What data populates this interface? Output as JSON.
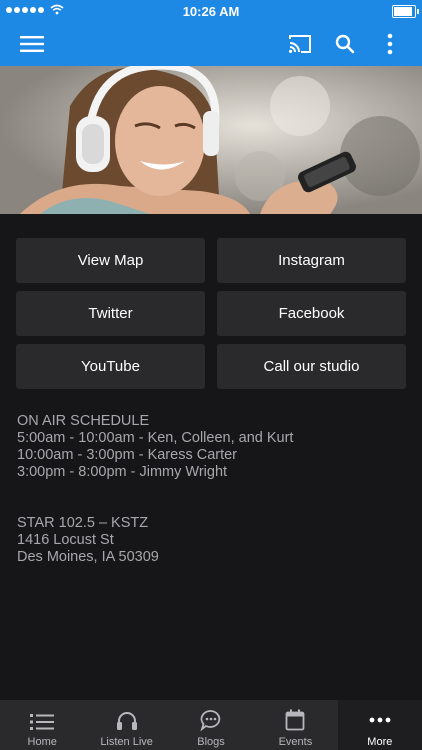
{
  "status_bar": {
    "time": "10:26 AM",
    "battery_level": 1.0
  },
  "toolbar": {
    "menu_icon": "hamburger-menu-icon",
    "cast_icon": "cast-icon",
    "search_icon": "search-icon",
    "more_icon": "more-vertical-icon",
    "background_color": "#1e88e5"
  },
  "buttons": [
    {
      "label": "View Map"
    },
    {
      "label": "Instagram"
    },
    {
      "label": "Twitter"
    },
    {
      "label": "Facebook"
    },
    {
      "label": "YouTube"
    },
    {
      "label": "Call our studio"
    }
  ],
  "schedule": {
    "heading": "ON AIR SCHEDULE",
    "lines": [
      "5:00am - 10:00am - Ken, Colleen, and Kurt",
      "10:00am - 3:00pm - Karess Carter",
      "3:00pm - 8:00pm - Jimmy Wright"
    ]
  },
  "station": {
    "name": "STAR 102.5 – KSTZ",
    "street": "1416 Locust St",
    "city": "Des Moines, IA 50309"
  },
  "tabs": [
    {
      "label": "Home",
      "icon": "list-icon",
      "active": false
    },
    {
      "label": "Listen Live",
      "icon": "headphones-icon",
      "active": false
    },
    {
      "label": "Blogs",
      "icon": "chat-bubble-icon",
      "active": false
    },
    {
      "label": "Events",
      "icon": "calendar-icon",
      "active": false
    },
    {
      "label": "More",
      "icon": "more-horizontal-icon",
      "active": true
    }
  ]
}
